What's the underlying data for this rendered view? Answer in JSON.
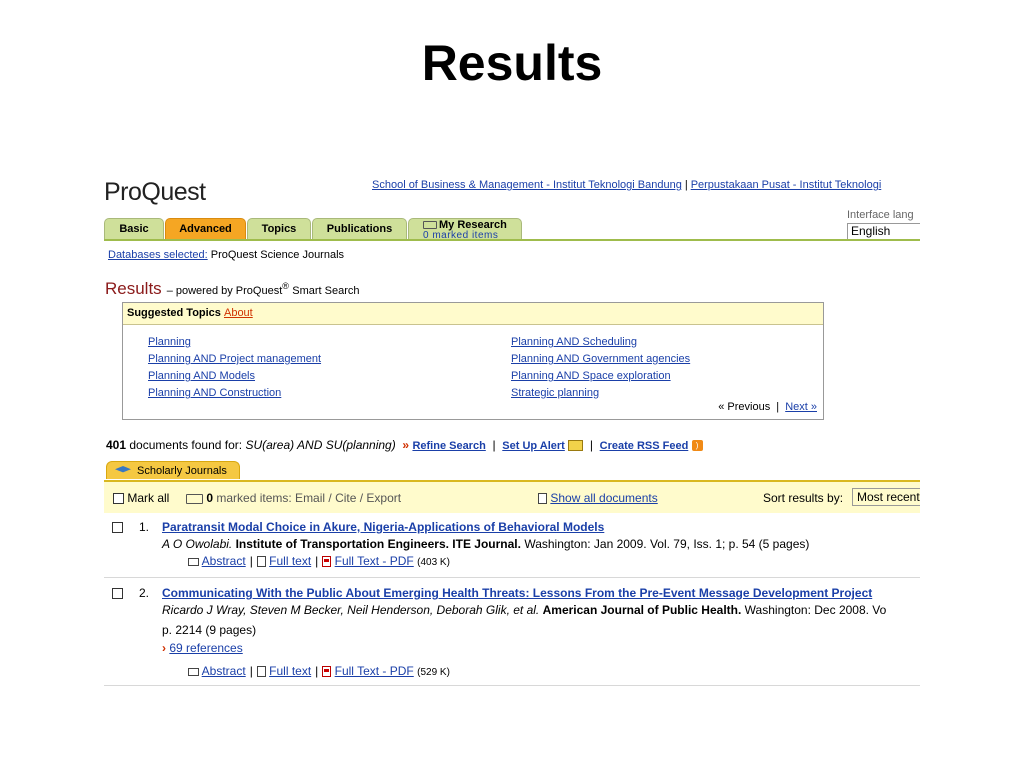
{
  "slide": {
    "title": "Results"
  },
  "header": {
    "logo": "ProQuest",
    "institution_link_1": "School of Business & Management - Institut Teknologi Bandung",
    "separator": "|",
    "institution_link_2": "Perpustakaan Pusat - Institut Teknologi",
    "interface_label": "Interface lang",
    "language": "English"
  },
  "tabs": {
    "basic": "Basic",
    "advanced": "Advanced",
    "topics": "Topics",
    "publications": "Publications",
    "my_research": "My Research",
    "marked_items": "0 marked items"
  },
  "databases": {
    "label": "Databases selected:",
    "value": "ProQuest Science Journals"
  },
  "results_heading": {
    "title": "Results",
    "powered": "– powered by ProQuest",
    "reg": "®",
    "smart": "Smart Search"
  },
  "suggested": {
    "heading": "Suggested Topics",
    "about": "About",
    "left": [
      "Planning",
      "Planning AND Project management",
      "Planning AND Models",
      "Planning AND Construction"
    ],
    "right": [
      "Planning AND Scheduling",
      "Planning AND Government agencies",
      "Planning AND Space exploration",
      "Strategic planning"
    ],
    "previous": "« Previous",
    "pager_sep": "|",
    "next": "Next »"
  },
  "found": {
    "count": "401",
    "text": "documents found for:",
    "query": "SU(area) AND SU(planning)",
    "arrows": "»",
    "refine": "Refine Search",
    "sep": "|",
    "alert": "Set Up Alert",
    "rss": "Create RSS Feed"
  },
  "source_tab": "Scholarly Journals",
  "toolbar": {
    "mark_all": "Mark all",
    "marked_count": "0",
    "marked_text": "marked items: Email / Cite / Export",
    "show_all": "Show all documents",
    "sort_label": "Sort results by:",
    "sort_value": "Most recent"
  },
  "results": [
    {
      "num": "1.",
      "title": "Paratransit Modal Choice in Akure, Nigeria-Applications of Behavioral Models",
      "author": "A O Owolabi.",
      "journal": "Institute of Transportation Engineers. ITE Journal.",
      "details": "Washington: Jan 2009. Vol. 79, Iss. 1; p. 54 (5 pages)",
      "abstract": "Abstract",
      "fulltext": "Full text",
      "pdf": "Full Text - PDF",
      "size": "(403 K)"
    },
    {
      "num": "2.",
      "title": "Communicating With the Public About Emerging Health Threats: Lessons From the Pre-Event Message Development Project",
      "author": "Ricardo J Wray, Steven M Becker, Neil Henderson, Deborah Glik, et al.",
      "journal": "American Journal of Public Health.",
      "details": "Washington: Dec 2008. Vo",
      "details2": "p. 2214 (9 pages)",
      "refs": "69 references",
      "abstract": "Abstract",
      "fulltext": "Full text",
      "pdf": "Full Text - PDF",
      "size": "(529 K)"
    }
  ]
}
